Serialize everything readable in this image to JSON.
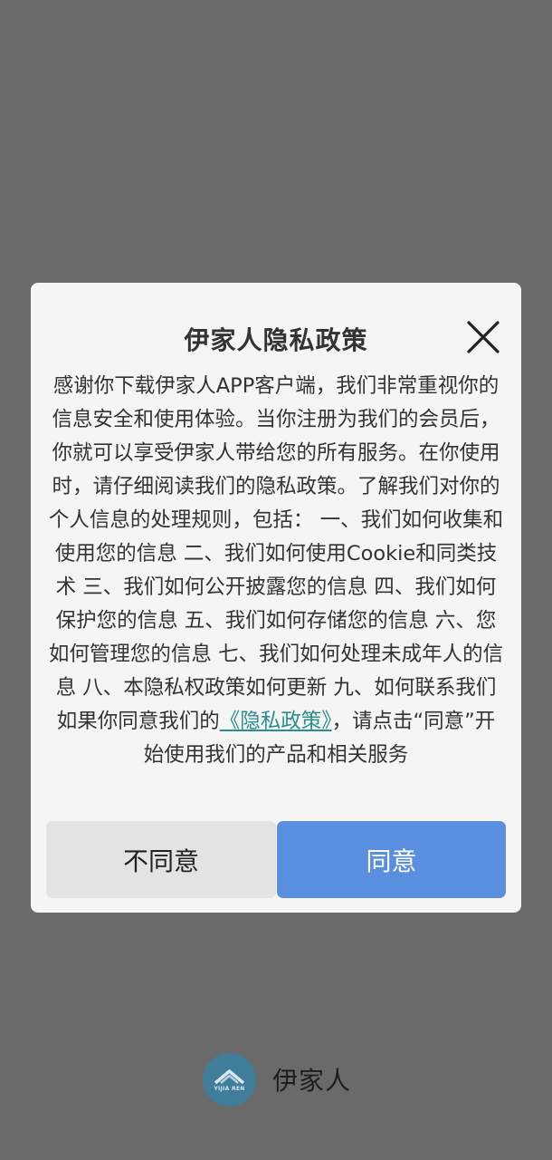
{
  "dialog": {
    "title": "伊家人隐私政策",
    "body_before_link": "感谢你下载伊家人APP客户端，我们非常重视你的信息安全和使用体验。当你注册为我们的会员后，你就可以享受伊家人带给您的所有服务。在你使用时，请仔细阅读我们的隐私政策。了解我们对你的个人信息的处理规则，包括： 一、我们如何收集和使用您的信息 二、我们如何使用Cookie和同类技术 三、我们如何公开披露您的信息 四、我们如何保护您的信息 五、我们如何存储您的信息 六、您如何管理您的信息 七、我们如何处理未成年人的信息 八、本隐私权政策如何更新 九、如何联系我们 如果你同意我们的",
    "link_text": "《隐私政策》",
    "body_after_link": "，请点击“同意”开始使用我们的产品和相关服务",
    "disagree_label": "不同意",
    "agree_label": "同意",
    "close_icon": "close-icon"
  },
  "footer": {
    "logo_text": "YIJIA REN",
    "app_name": "伊家人"
  },
  "colors": {
    "overlay": "#6a6a6a",
    "dialog_bg": "#f5f5f5",
    "agree_button": "#5a8fe0",
    "disagree_button": "#e3e3e3",
    "link": "#2a8f8a",
    "logo": "#3f7d9a"
  }
}
